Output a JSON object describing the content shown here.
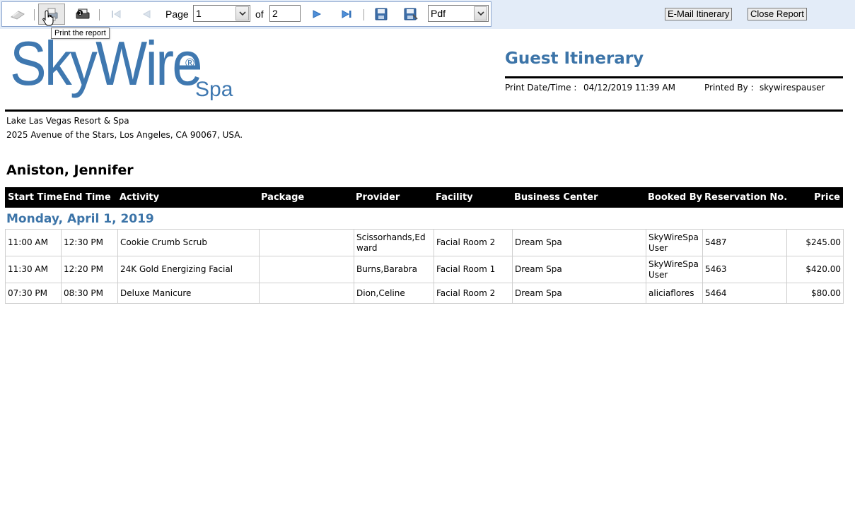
{
  "toolbar": {
    "page_label": "Page",
    "page_value": "1",
    "of_label": "of",
    "total_pages": "2",
    "format_value": "Pdf",
    "tooltip": "Print the report",
    "email_button": "E-Mail Itinerary",
    "close_button": "Close Report"
  },
  "logo": {
    "main": "SkyWire",
    "reg": "®",
    "sub": "Spa"
  },
  "report": {
    "title": "Guest Itinerary",
    "print_date_label": "Print Date/Time :",
    "print_date_value": "04/12/2019 11:39 AM",
    "printed_by_label": "Printed By :",
    "printed_by_value": "skywirespauser",
    "address_line1": "Lake Las Vegas Resort & Spa",
    "address_line2": "2025 Avenue of the Stars, Los Angeles, CA 90067, USA.",
    "guest_name": "Aniston, Jennifer"
  },
  "table": {
    "headers": {
      "start": "Start Time",
      "end": "End Time",
      "activity": "Activity",
      "package": "Package",
      "provider": "Provider",
      "facility": "Facility",
      "business": "Business Center",
      "booked": "Booked By",
      "resno": "Reservation No.",
      "price": "Price"
    },
    "day_label": "Monday, April 1, 2019",
    "rows": [
      {
        "start": "11:00 AM",
        "end": "12:30 PM",
        "activity": "Cookie Crumb Scrub",
        "package": "",
        "provider": "Scissorhands,Edward",
        "facility": "Facial Room 2",
        "business": "Dream Spa",
        "booked": "SkyWireSpa User",
        "resno": "5487",
        "price": "$245.00"
      },
      {
        "start": "11:30 AM",
        "end": "12:20 PM",
        "activity": "24K Gold Energizing Facial",
        "package": "",
        "provider": "Burns,Barabra",
        "facility": "Facial Room 1",
        "business": "Dream Spa",
        "booked": "SkyWireSpa User",
        "resno": "5463",
        "price": "$420.00"
      },
      {
        "start": "07:30 PM",
        "end": "08:30 PM",
        "activity": "Deluxe Manicure",
        "package": "",
        "provider": "Dion,Celine",
        "facility": "Facial Room 2",
        "business": "Dream Spa",
        "booked": "aliciaflores",
        "resno": "5464",
        "price": "$80.00"
      }
    ]
  },
  "colors": {
    "brand_blue": "#3f78b0",
    "title_blue": "#3c74a8",
    "toolbar_bg": "#e3ecf8"
  },
  "icons": [
    "export-icon",
    "print-icon",
    "print-setup-icon",
    "first-page-icon",
    "prev-page-icon",
    "next-page-icon",
    "last-page-icon",
    "save-icon",
    "save-as-icon",
    "chevron-down-icon"
  ]
}
